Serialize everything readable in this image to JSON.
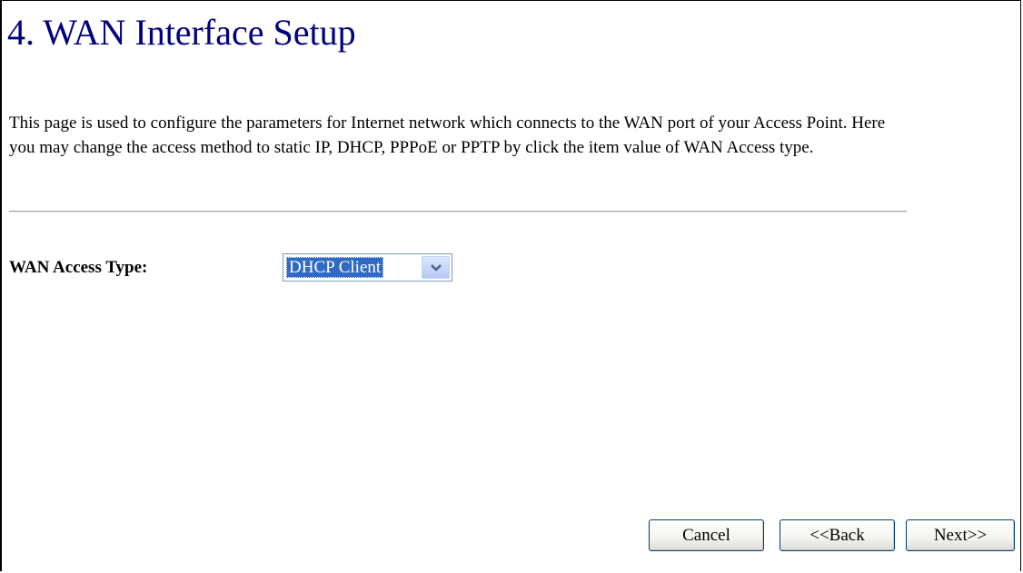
{
  "page": {
    "title": "4. WAN Interface Setup",
    "description": "This page is used to configure the parameters for Internet network which connects to the WAN port of your Access Point. Here you may change the access method to static IP, DHCP, PPPoE or PPTP by click the item value of WAN Access type."
  },
  "form": {
    "wan_access_type_label": "WAN Access Type:",
    "wan_access_type_value": "DHCP Client"
  },
  "buttons": {
    "cancel_label": "Cancel",
    "back_label": "<<Back",
    "next_label": "Next>>"
  },
  "colors": {
    "title": "#000080",
    "select_highlight": "#316ac5",
    "button_border": "#003c74"
  },
  "icons": {
    "select_arrow": "chevron-down-icon"
  }
}
